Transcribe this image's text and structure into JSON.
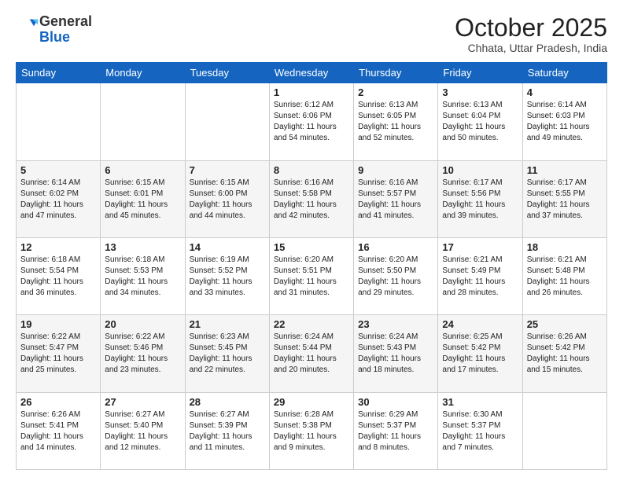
{
  "header": {
    "logo_general": "General",
    "logo_blue": "Blue",
    "month_year": "October 2025",
    "location": "Chhata, Uttar Pradesh, India"
  },
  "days_of_week": [
    "Sunday",
    "Monday",
    "Tuesday",
    "Wednesday",
    "Thursday",
    "Friday",
    "Saturday"
  ],
  "weeks": [
    [
      {
        "day": "",
        "info": ""
      },
      {
        "day": "",
        "info": ""
      },
      {
        "day": "",
        "info": ""
      },
      {
        "day": "1",
        "info": "Sunrise: 6:12 AM\nSunset: 6:06 PM\nDaylight: 11 hours and 54 minutes."
      },
      {
        "day": "2",
        "info": "Sunrise: 6:13 AM\nSunset: 6:05 PM\nDaylight: 11 hours and 52 minutes."
      },
      {
        "day": "3",
        "info": "Sunrise: 6:13 AM\nSunset: 6:04 PM\nDaylight: 11 hours and 50 minutes."
      },
      {
        "day": "4",
        "info": "Sunrise: 6:14 AM\nSunset: 6:03 PM\nDaylight: 11 hours and 49 minutes."
      }
    ],
    [
      {
        "day": "5",
        "info": "Sunrise: 6:14 AM\nSunset: 6:02 PM\nDaylight: 11 hours and 47 minutes."
      },
      {
        "day": "6",
        "info": "Sunrise: 6:15 AM\nSunset: 6:01 PM\nDaylight: 11 hours and 45 minutes."
      },
      {
        "day": "7",
        "info": "Sunrise: 6:15 AM\nSunset: 6:00 PM\nDaylight: 11 hours and 44 minutes."
      },
      {
        "day": "8",
        "info": "Sunrise: 6:16 AM\nSunset: 5:58 PM\nDaylight: 11 hours and 42 minutes."
      },
      {
        "day": "9",
        "info": "Sunrise: 6:16 AM\nSunset: 5:57 PM\nDaylight: 11 hours and 41 minutes."
      },
      {
        "day": "10",
        "info": "Sunrise: 6:17 AM\nSunset: 5:56 PM\nDaylight: 11 hours and 39 minutes."
      },
      {
        "day": "11",
        "info": "Sunrise: 6:17 AM\nSunset: 5:55 PM\nDaylight: 11 hours and 37 minutes."
      }
    ],
    [
      {
        "day": "12",
        "info": "Sunrise: 6:18 AM\nSunset: 5:54 PM\nDaylight: 11 hours and 36 minutes."
      },
      {
        "day": "13",
        "info": "Sunrise: 6:18 AM\nSunset: 5:53 PM\nDaylight: 11 hours and 34 minutes."
      },
      {
        "day": "14",
        "info": "Sunrise: 6:19 AM\nSunset: 5:52 PM\nDaylight: 11 hours and 33 minutes."
      },
      {
        "day": "15",
        "info": "Sunrise: 6:20 AM\nSunset: 5:51 PM\nDaylight: 11 hours and 31 minutes."
      },
      {
        "day": "16",
        "info": "Sunrise: 6:20 AM\nSunset: 5:50 PM\nDaylight: 11 hours and 29 minutes."
      },
      {
        "day": "17",
        "info": "Sunrise: 6:21 AM\nSunset: 5:49 PM\nDaylight: 11 hours and 28 minutes."
      },
      {
        "day": "18",
        "info": "Sunrise: 6:21 AM\nSunset: 5:48 PM\nDaylight: 11 hours and 26 minutes."
      }
    ],
    [
      {
        "day": "19",
        "info": "Sunrise: 6:22 AM\nSunset: 5:47 PM\nDaylight: 11 hours and 25 minutes."
      },
      {
        "day": "20",
        "info": "Sunrise: 6:22 AM\nSunset: 5:46 PM\nDaylight: 11 hours and 23 minutes."
      },
      {
        "day": "21",
        "info": "Sunrise: 6:23 AM\nSunset: 5:45 PM\nDaylight: 11 hours and 22 minutes."
      },
      {
        "day": "22",
        "info": "Sunrise: 6:24 AM\nSunset: 5:44 PM\nDaylight: 11 hours and 20 minutes."
      },
      {
        "day": "23",
        "info": "Sunrise: 6:24 AM\nSunset: 5:43 PM\nDaylight: 11 hours and 18 minutes."
      },
      {
        "day": "24",
        "info": "Sunrise: 6:25 AM\nSunset: 5:42 PM\nDaylight: 11 hours and 17 minutes."
      },
      {
        "day": "25",
        "info": "Sunrise: 6:26 AM\nSunset: 5:42 PM\nDaylight: 11 hours and 15 minutes."
      }
    ],
    [
      {
        "day": "26",
        "info": "Sunrise: 6:26 AM\nSunset: 5:41 PM\nDaylight: 11 hours and 14 minutes."
      },
      {
        "day": "27",
        "info": "Sunrise: 6:27 AM\nSunset: 5:40 PM\nDaylight: 11 hours and 12 minutes."
      },
      {
        "day": "28",
        "info": "Sunrise: 6:27 AM\nSunset: 5:39 PM\nDaylight: 11 hours and 11 minutes."
      },
      {
        "day": "29",
        "info": "Sunrise: 6:28 AM\nSunset: 5:38 PM\nDaylight: 11 hours and 9 minutes."
      },
      {
        "day": "30",
        "info": "Sunrise: 6:29 AM\nSunset: 5:37 PM\nDaylight: 11 hours and 8 minutes."
      },
      {
        "day": "31",
        "info": "Sunrise: 6:30 AM\nSunset: 5:37 PM\nDaylight: 11 hours and 7 minutes."
      },
      {
        "day": "",
        "info": ""
      }
    ]
  ]
}
